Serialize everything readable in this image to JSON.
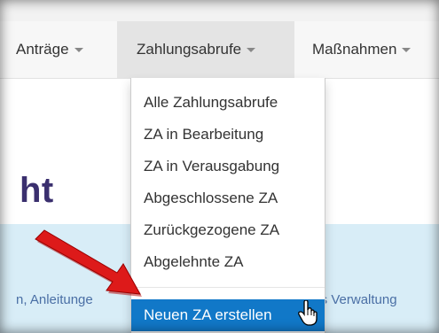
{
  "nav": {
    "items": [
      {
        "label": "Anträge"
      },
      {
        "label": "Zahlungsabrufe"
      },
      {
        "label": "Maßnahmen"
      }
    ]
  },
  "dropdown": {
    "items": [
      {
        "label": "Alle Zahlungsabrufe"
      },
      {
        "label": "ZA in Bearbeitung"
      },
      {
        "label": "ZA in Verausgabung"
      },
      {
        "label": "Abgeschlossene ZA"
      },
      {
        "label": "Zurückgezogene ZA"
      },
      {
        "label": "Abgelehnte ZA"
      }
    ],
    "highlighted": {
      "label": "Neuen ZA erstellen"
    }
  },
  "page": {
    "heading_fragment": "ht",
    "info_left_fragment": "n, Anleitunge",
    "info_right_fragment": "les Verwaltung"
  },
  "colors": {
    "heading": "#3a2f6e",
    "highlight": "#1178c8",
    "info_bg": "#d8edf7",
    "arrow": "#cc1111"
  },
  "icons": {
    "arrow": "red-arrow-icon",
    "cursor": "hand-pointer-icon"
  }
}
